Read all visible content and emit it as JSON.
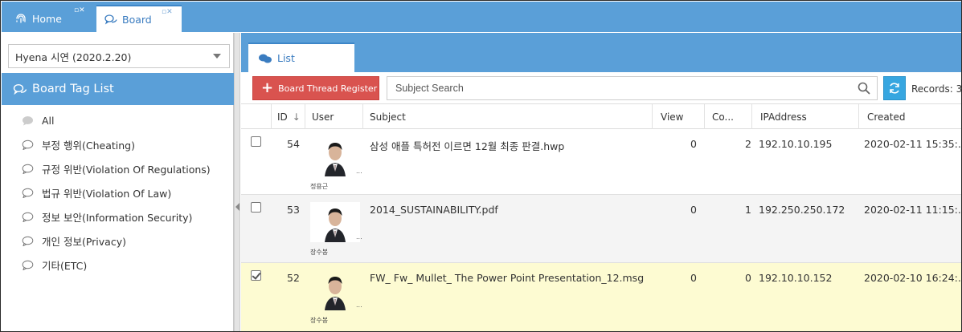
{
  "tabs": {
    "home": {
      "label": "Home",
      "icon": "fingerprint-icon"
    },
    "board": {
      "label": "Board",
      "icon": "chat-bubbles-icon"
    }
  },
  "sidebar": {
    "project_select": "Hyena 시연 (2020.2.20)",
    "tag_header": "Board Tag List",
    "tags": [
      {
        "label": "All",
        "selected": true
      },
      {
        "label": "부정 행위(Cheating)"
      },
      {
        "label": "규정 위반(Violation Of Regulations)"
      },
      {
        "label": "법규 위반(Violation Of Law)"
      },
      {
        "label": "정보 보안(Information Security)"
      },
      {
        "label": "개인 정보(Privacy)"
      },
      {
        "label": "기타(ETC)"
      }
    ]
  },
  "main": {
    "list_tab": "List",
    "register_button": "Board Thread Register",
    "search_placeholder": "Subject Search",
    "records": "Records: 3",
    "columns": {
      "id": "ID",
      "user": "User",
      "subject": "Subject",
      "view": "View",
      "comments": "Co...",
      "ip": "IPAddress",
      "created": "Created"
    },
    "rows": [
      {
        "id": "54",
        "user": "정용근",
        "subject": "삼성 애플 특허전 이르면 12월 최종 판결.hwp",
        "view": "0",
        "comments": "2",
        "ip": "192.10.10.195",
        "created": "2020-02-11 15:35:...",
        "checked": false
      },
      {
        "id": "53",
        "user": "장수봉",
        "subject": "2014_SUSTAINABILITY.pdf",
        "view": "0",
        "comments": "1",
        "ip": "192.250.250.172",
        "created": "2020-02-11 11:15:...",
        "checked": false
      },
      {
        "id": "52",
        "user": "장수봉",
        "subject": "FW_ Fw_ Mullet_ The Power Point Presentation_12.msg",
        "view": "0",
        "comments": "0",
        "ip": "192.10.10.152",
        "created": "2020-02-10 16:24:...",
        "checked": true
      }
    ]
  },
  "colors": {
    "header_blue": "#5a9fd8",
    "register_red": "#d9534f",
    "refresh_blue": "#37a6e0",
    "selected_row": "#fdfbd2"
  }
}
